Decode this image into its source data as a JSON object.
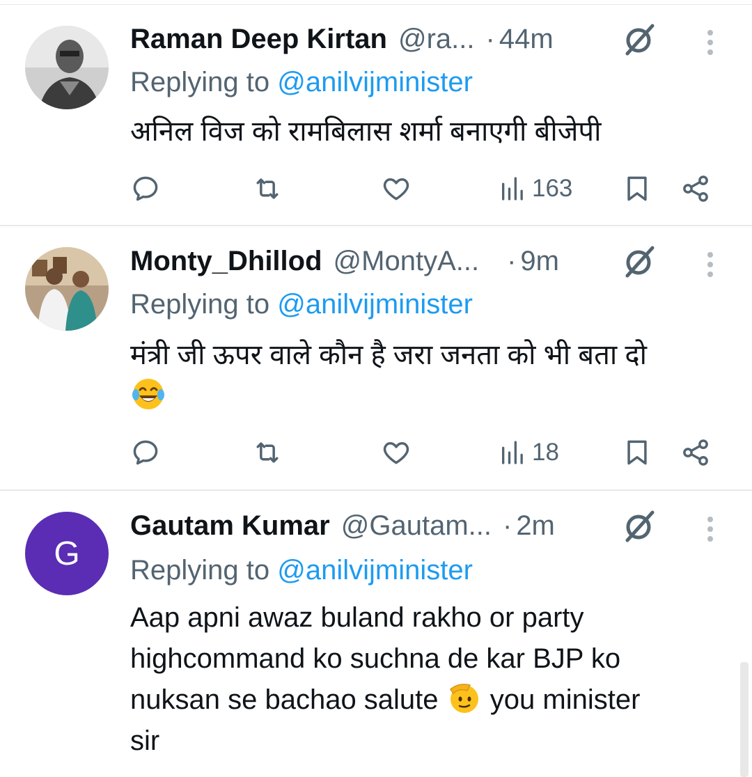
{
  "colors": {
    "accent": "#1d9bf0",
    "secondary_text": "#536471",
    "primary_text": "#0f1419",
    "divider": "#e6e9ea",
    "avatar_purple": "#5a2db4"
  },
  "replying_prefix": "Replying to",
  "tweets": [
    {
      "name": "Raman Deep Kirtan",
      "handle": "@ra...",
      "dot": "·",
      "time": "44m",
      "replying_to": "@anilvijminister",
      "text": "अनिल विज को रामबिलास शर्मा बनाएगी बीजेपी",
      "text_emoji": "",
      "views": "163",
      "icons": [
        "reply-icon",
        "retweet-icon",
        "like-icon",
        "views-icon",
        "bookmark-icon",
        "share-icon"
      ]
    },
    {
      "name": "Monty_Dhillod",
      "handle": "@MontyA...",
      "dot": "·",
      "time": "9m",
      "replying_to": "@anilvijminister",
      "text": "मंत्री जी ऊपर वाले कौन है जरा जनता को भी बता दो",
      "text_emoji": "😂",
      "views": "18",
      "icons": [
        "reply-icon",
        "retweet-icon",
        "like-icon",
        "views-icon",
        "bookmark-icon",
        "share-icon"
      ]
    },
    {
      "name": "Gautam Kumar",
      "handle": "@Gautam...",
      "dot": "·",
      "time": "2m",
      "replying_to": "@anilvijminister",
      "avatar_letter": "G",
      "text_lines": [
        "Aap apni awaz buland rakho or party",
        "highcommand ko suchna de kar BJP ko",
        "nuksan se bachao salute",
        "you minister",
        "sir"
      ],
      "text_emoji": "🫡"
    }
  ]
}
